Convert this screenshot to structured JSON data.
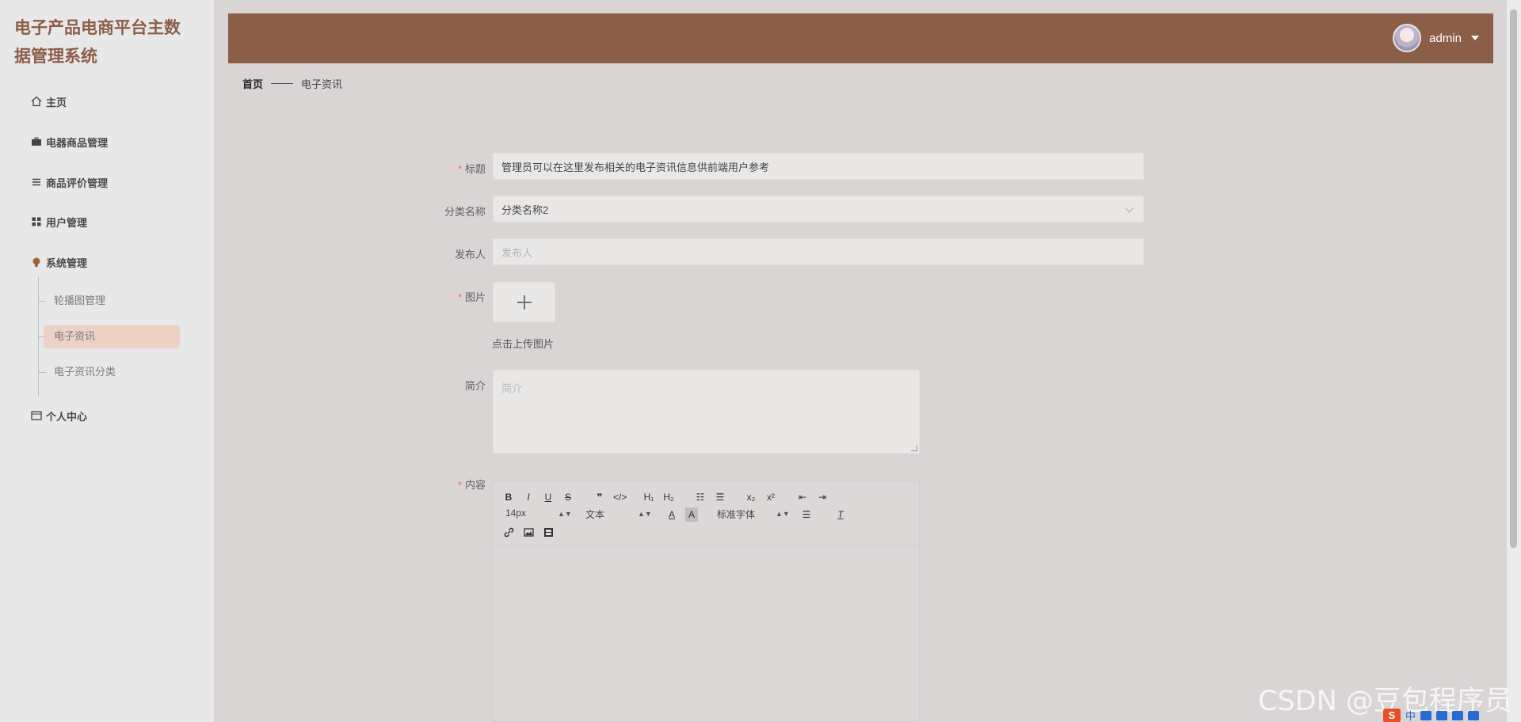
{
  "app": {
    "title": "电子产品电商平台主数据管理系统"
  },
  "sidebar": {
    "items": [
      {
        "label": "主页",
        "icon": "home-icon"
      },
      {
        "label": "电器商品管理",
        "icon": "briefcase-icon"
      },
      {
        "label": "商品评价管理",
        "icon": "list-icon"
      },
      {
        "label": "用户管理",
        "icon": "grid-icon"
      },
      {
        "label": "系统管理",
        "icon": "bulb-icon"
      },
      {
        "label": "个人中心",
        "icon": "card-icon"
      }
    ],
    "submenu": [
      "轮播图管理",
      "电子资讯",
      "电子资讯分类"
    ],
    "active_sub": "电子资讯"
  },
  "header": {
    "user": "admin"
  },
  "breadcrumb": {
    "home": "首页",
    "current": "电子资讯"
  },
  "form": {
    "title_label": "标题",
    "title_value": "管理员可以在这里发布相关的电子资讯信息供前端用户参考",
    "category_label": "分类名称",
    "category_value": "分类名称2",
    "publisher_label": "发布人",
    "publisher_placeholder": "发布人",
    "image_label": "图片",
    "upload_tip": "点击上传图片",
    "intro_label": "简介",
    "intro_placeholder": "简介",
    "content_label": "内容"
  },
  "editor": {
    "bold": "B",
    "italic": "I",
    "underline": "U",
    "strike": "S",
    "quote": "❞",
    "code": "</>",
    "h1": "H₁",
    "h2": "H₂",
    "ordered": "☷",
    "bullet": "☰",
    "sub": "x₂",
    "sup": "x²",
    "outdent": "⇤",
    "indent": "⇥",
    "size": "14px",
    "type": "文本",
    "font": "标准字体",
    "color": "A",
    "bg": "A",
    "align": "☰",
    "clear": "T",
    "link": "🔗",
    "image": "▣",
    "video": "▤"
  },
  "watermark": "CSDN @豆包程序员",
  "tray": {
    "s": "S",
    "lang": "中"
  }
}
